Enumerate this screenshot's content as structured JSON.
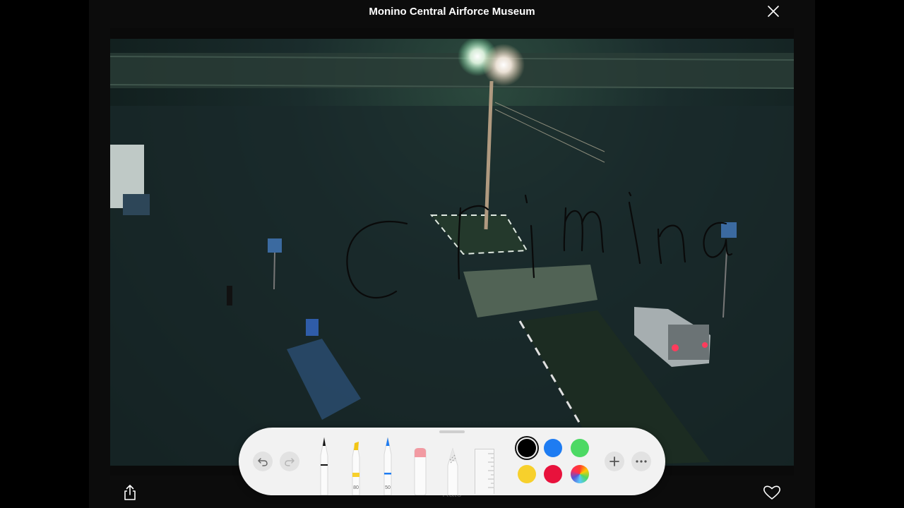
{
  "header": {
    "title": "Monino Central Airforce Museum"
  },
  "photo": {
    "description_hidden": ""
  },
  "bottom": {
    "label": "Rate"
  },
  "markup": {
    "tools": [
      {
        "name": "pen",
        "label": ""
      },
      {
        "name": "highlighter",
        "label": "80"
      },
      {
        "name": "pencil",
        "label": "50"
      },
      {
        "name": "eraser",
        "label": ""
      },
      {
        "name": "lasso",
        "label": ""
      },
      {
        "name": "ruler",
        "label": ""
      }
    ],
    "colors": {
      "black": "#000000",
      "blue": "#1e7cf2",
      "green": "#4cd964",
      "yellow": "#f7d02c",
      "red": "#e8123c"
    },
    "selected_color": "black"
  }
}
